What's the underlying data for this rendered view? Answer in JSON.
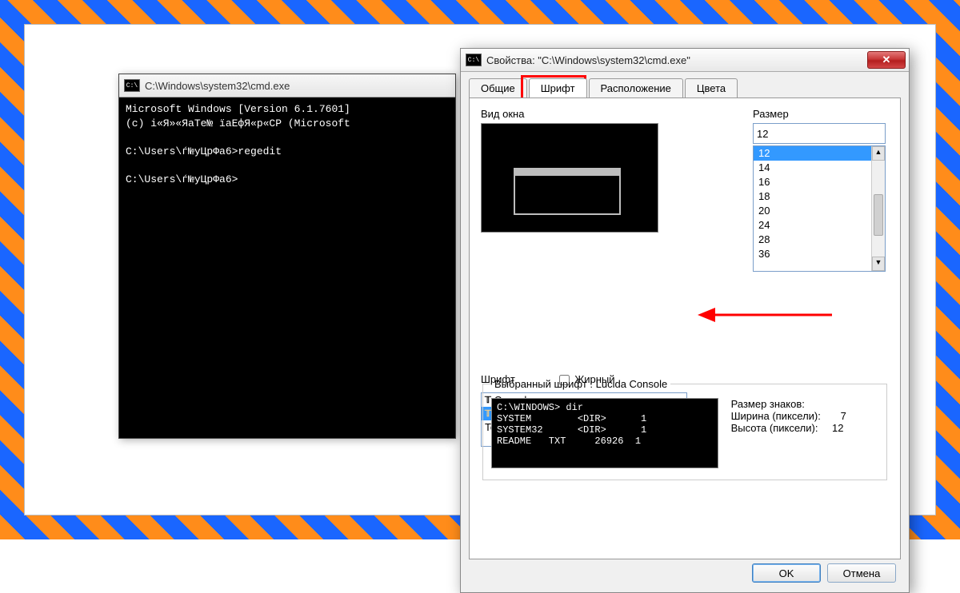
{
  "cmd": {
    "title": "C:\\Windows\\system32\\cmd.exe",
    "line1": "Microsoft Windows [Version 6.1.7601]",
    "line2": "(c) і«Я»«ЯаТе№ їаЕфЯ«р«СР (Microsoft",
    "line3": "C:\\Users\\ѓ№уЦрФа6>regedit",
    "line4": "C:\\Users\\ѓ№уЦрФа6>"
  },
  "props": {
    "title": "Свойства: \"C:\\Windows\\system32\\cmd.exe\"",
    "tabs": {
      "general": "Общие",
      "font": "Шрифт",
      "layout": "Расположение",
      "colors": "Цвета"
    },
    "window_preview_label": "Вид окна",
    "size_label": "Размер",
    "size_value": "12",
    "sizes": [
      "12",
      "14",
      "16",
      "18",
      "20",
      "24",
      "28",
      "36"
    ],
    "font_label": "Шрифт",
    "bold_label": "Жирный",
    "fonts": {
      "consolas": "Consolas",
      "lucida": "Lucida Console",
      "raster": "Точечные шрифты"
    },
    "selected_font_label": "Выбранный шрифт : Lucida Console",
    "sample": {
      "l1": "C:\\WINDOWS> dir",
      "l2": "SYSTEM        <DIR>      1",
      "l3": "SYSTEM32      <DIR>      1",
      "l4": "README   TXT     26926  1"
    },
    "metrics": {
      "title": "Размер знаков:",
      "width_label": "Ширина (пиксели):",
      "width": "7",
      "height_label": "Высота (пиксели):",
      "height": "12"
    },
    "ok": "OK",
    "cancel": "Отмена"
  }
}
